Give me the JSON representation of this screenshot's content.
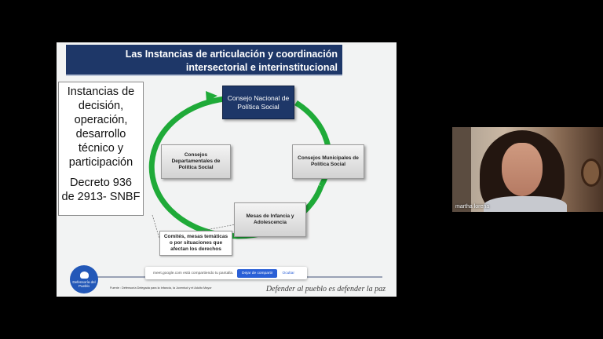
{
  "slide": {
    "title_line1": "Las Instancias de articulación  y coordinación",
    "title_line2": "intersectorial e interinstitucional",
    "left_box": {
      "lines": [
        "Instancias de",
        "decisión,",
        "operación,",
        "desarrollo",
        "técnico y",
        "participación"
      ],
      "decree_line1": "Decreto 936",
      "decree_line2": "de 2913- SNBF"
    },
    "nodes": {
      "national": "Consejo Nacional de Política Social",
      "departmental": "Consejos Departamentales de Política Social",
      "municipal": "Consejos Municipales de Política Social",
      "mesas": "Mesas de Infancia y Adolescencia",
      "comites": "Comités, mesas temáticas o por situaciones que afectan los derechos"
    },
    "footer": {
      "logo_text": "Defensoría del Pueblo",
      "source": "Fuente : Defensoría Delegada para la Infancia, la Juventud y el Adulto Mayor",
      "motto": "Defender al pueblo es defender la paz"
    },
    "colors": {
      "title_bg": "#1e3768",
      "cycle_arrow": "#1faa38"
    }
  },
  "share_banner": {
    "message": "meet.google.com está compartiendo tu pantalla.",
    "stop_label": "Dejar de compartir",
    "hide_label": "Ocultar"
  },
  "participant": {
    "name": "martha lorena"
  }
}
